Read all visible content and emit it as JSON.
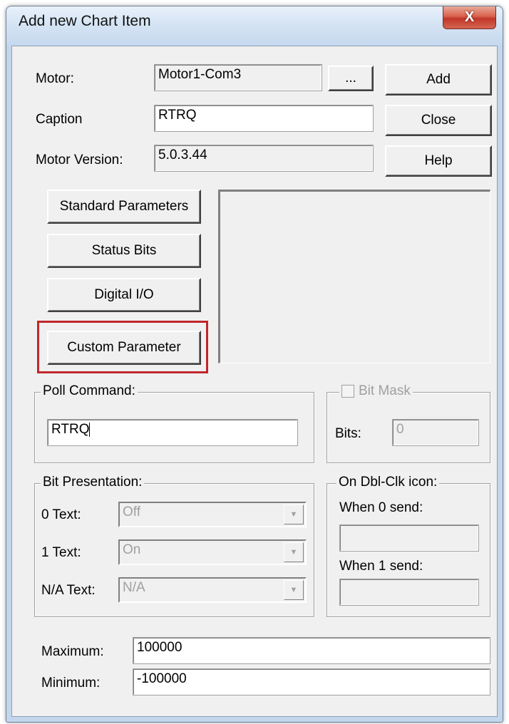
{
  "window": {
    "title": "Add new Chart Item",
    "close_glyph": "X"
  },
  "motor": {
    "label": "Motor:",
    "value": "Motor1-Com3",
    "browse_label": "..."
  },
  "caption": {
    "label": "Caption",
    "value": "RTRQ"
  },
  "motor_version": {
    "label": "Motor Version:",
    "value": "5.0.3.44"
  },
  "buttons": {
    "add": "Add",
    "close": "Close",
    "help": "Help"
  },
  "param_buttons": {
    "standard": "Standard Parameters",
    "status_bits": "Status Bits",
    "digital_io": "Digital I/O",
    "custom": "Custom Parameter"
  },
  "poll_command": {
    "legend": "Poll Command:",
    "value": "RTRQ"
  },
  "bit_mask": {
    "legend": "Bit Mask",
    "bits_label": "Bits:",
    "bits_value": "0"
  },
  "bit_presentation": {
    "legend": "Bit Presentation:",
    "zero_label": "0 Text:",
    "zero_value": "Off",
    "one_label": "1 Text:",
    "one_value": "On",
    "na_label": "N/A Text:",
    "na_value": "N/A"
  },
  "dblclick": {
    "legend": "On Dbl-Clk icon:",
    "when0_label": "When 0 send:",
    "when0_value": "",
    "when1_label": "When 1 send:",
    "when1_value": ""
  },
  "range": {
    "max_label": "Maximum:",
    "max_value": "100000",
    "min_label": "Minimum:",
    "min_value": "-100000"
  },
  "colors": {
    "highlight": "#c0262b",
    "close_button": "#c1372a"
  },
  "icons": {
    "close": "close-icon",
    "dropdown": "chevron-down-icon",
    "checkbox": "checkbox-icon"
  }
}
